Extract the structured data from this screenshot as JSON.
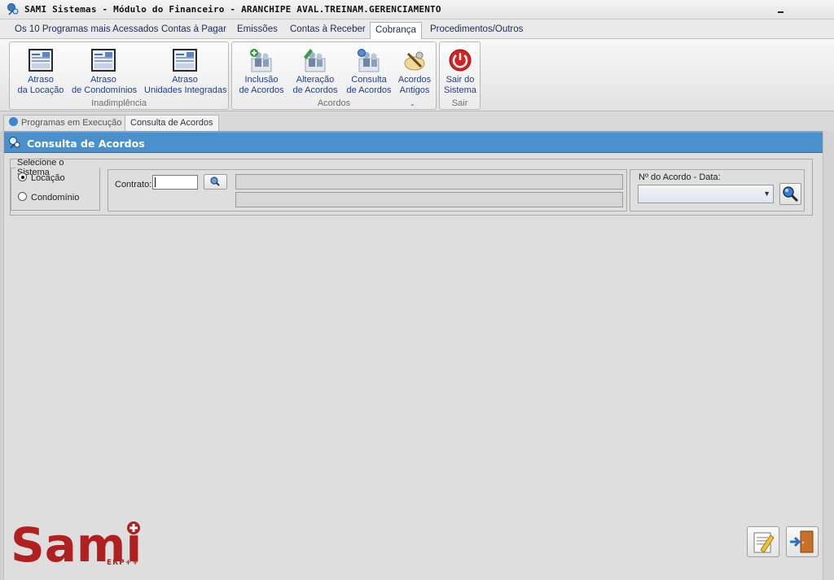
{
  "window": {
    "title": "SAMI Sistemas - Módulo do Financeiro - ARANCHIPE AVAL.TREINAM.GERENCIAMENTO"
  },
  "menu": {
    "tabs": [
      {
        "label": "Os 10 Programas mais Acessados"
      },
      {
        "label": "Contas à Pagar"
      },
      {
        "label": "Emissões"
      },
      {
        "label": "Contas à Receber"
      },
      {
        "label": "Cobrança"
      },
      {
        "label": "Procedimentos/Outros"
      }
    ],
    "active": "Cobrança"
  },
  "ribbon": {
    "groups": [
      {
        "label": "Inadimplência",
        "buttons": [
          {
            "line1": "Atraso",
            "line2": "da Locação",
            "icon": "report-icon"
          },
          {
            "line1": "Atraso",
            "line2": "de Condomínios",
            "icon": "report-icon"
          },
          {
            "line1": "Atraso",
            "line2": "Unidades Integradas",
            "icon": "report-icon"
          }
        ]
      },
      {
        "label": "Acordos",
        "buttons": [
          {
            "line1": "Inclusão",
            "line2": "de Acordos",
            "icon": "add-agreement-icon"
          },
          {
            "line1": "Alteração",
            "line2": "de Acordos",
            "icon": "edit-agreement-icon"
          },
          {
            "line1": "Consulta",
            "line2": "de Acordos",
            "icon": "search-agreement-icon"
          },
          {
            "line1": "Acordos",
            "line2": "Antigos",
            "icon": "old-agreements-icon"
          }
        ]
      },
      {
        "label": "Sair",
        "buttons": [
          {
            "line1": "Sair do",
            "line2": "Sistema",
            "icon": "power-icon"
          }
        ]
      }
    ]
  },
  "doc_tabs": [
    {
      "label": "Programas em Execução"
    },
    {
      "label": "Consulta de Acordos"
    }
  ],
  "form": {
    "title": "Consulta de Acordos",
    "system_group_label": "Selecione o Sistema",
    "radio_options": [
      {
        "label": "Locação",
        "checked": true
      },
      {
        "label": "Condomínio",
        "checked": false
      }
    ],
    "contract_label": "Contrato:",
    "contract_value": "",
    "agreement_label": "Nº do Acordo - Data:",
    "agreement_value": ""
  },
  "logo": {
    "text": "Sami",
    "sub": "ERP++"
  },
  "colors": {
    "header_blue": "#4a90cc",
    "logo_red": "#b02020",
    "power_red": "#d62222"
  }
}
